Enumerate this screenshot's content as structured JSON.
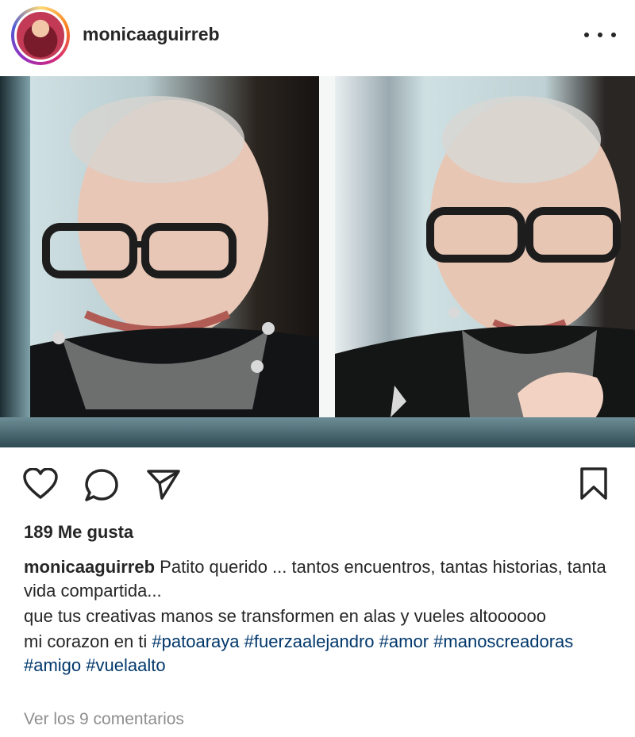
{
  "post": {
    "username": "monicaaguirreb",
    "likes_label": "189 Me gusta",
    "caption_text_1": "Patito querido ... tantos encuentros, tantas historias, tanta vida compartida...",
    "caption_text_2": "que tus creativas manos se transformen en alas y vueles altoooooo",
    "caption_text_3": "mi corazon en ti",
    "hashtags": [
      "#patoaraya",
      "#fuerzaalejandro",
      "#amor",
      "#manoscreadoras",
      "#amigo",
      "#vuelaalto"
    ],
    "comments_link": "Ver los 9 comentarios"
  },
  "icons": {
    "avatar": "profile-avatar",
    "more": "more-options-icon",
    "like": "heart-icon",
    "comment": "comment-icon",
    "share": "send-icon",
    "save": "bookmark-icon"
  },
  "colors": {
    "text": "#262626",
    "hashtag": "#00376b",
    "muted": "#8e8e8e"
  }
}
